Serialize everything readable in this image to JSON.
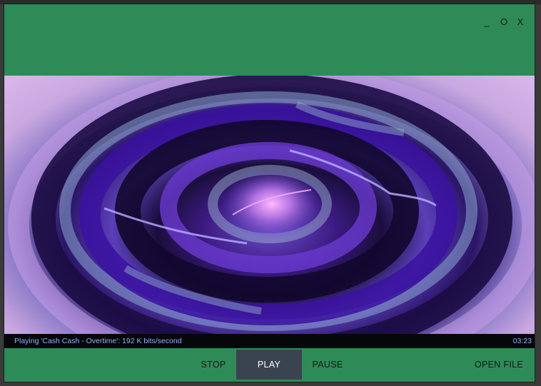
{
  "window": {
    "controls": {
      "minimize": "_",
      "maximize": "O",
      "close": "X"
    }
  },
  "visualizer": {
    "style": "purple swirl vortex",
    "colors": {
      "deep": "#1a0e3c",
      "mid": "#5a3fb8",
      "outer": "#c9a8e0",
      "glow": "#e6a8ff"
    }
  },
  "status": {
    "now_playing": "Playing 'Cash Cash - Overtime': 192 K bits/second",
    "time": "03:23"
  },
  "controls": {
    "stop_label": "STOP",
    "play_label": "PLAY",
    "pause_label": "PAUSE",
    "open_file_label": "OPEN FILE"
  },
  "theme": {
    "accent": "#2e8b57",
    "active_button": "#3a4350",
    "status_text": "#8fb1ff"
  }
}
